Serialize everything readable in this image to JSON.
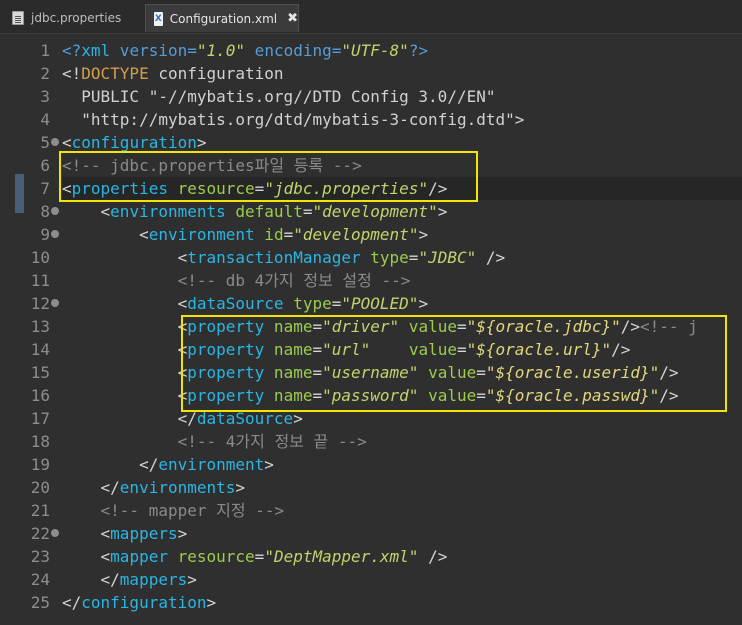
{
  "tabs": [
    {
      "label": "jdbc.properties",
      "icon": "properties-file-icon",
      "active": false
    },
    {
      "label": "Configuration.xml",
      "icon": "xml-file-icon",
      "active": true,
      "close": "✖"
    }
  ],
  "editor": {
    "lines": [
      {
        "n": "1",
        "tokens": [
          [
            "pi",
            "<?"
          ],
          [
            "tag",
            "xml"
          ],
          [
            "pi",
            " version="
          ],
          [
            "val",
            "\"1.0\""
          ],
          [
            "pi",
            " encoding="
          ],
          [
            "val",
            "\"UTF-8\""
          ],
          [
            "pi",
            "?>"
          ]
        ]
      },
      {
        "n": "2",
        "tokens": [
          [
            "pun",
            "<!"
          ],
          [
            "doctype",
            "DOCTYPE"
          ],
          [
            "doc",
            " configuration"
          ]
        ]
      },
      {
        "n": "3",
        "tokens": [
          [
            "doc",
            "  PUBLIC \"-//mybatis.org//DTD Config 3.0//EN\""
          ]
        ]
      },
      {
        "n": "4",
        "tokens": [
          [
            "doc",
            "  \"http://mybatis.org/dtd/mybatis-3-config.dtd\""
          ],
          [
            "pun",
            ">"
          ]
        ]
      },
      {
        "n": "5",
        "fold": true,
        "tokens": [
          [
            "pun",
            "<"
          ],
          [
            "tag",
            "configuration"
          ],
          [
            "pun",
            ">"
          ]
        ]
      },
      {
        "n": "6",
        "tokens": [
          [
            "com",
            "<!-- jdbc.properties파일 등록 -->"
          ]
        ]
      },
      {
        "n": "7",
        "current": true,
        "tokens": [
          [
            "pun",
            "<"
          ],
          [
            "tag",
            "properties"
          ],
          [
            "attr",
            " resource"
          ],
          [
            "pun",
            "="
          ],
          [
            "val",
            "\"jdbc.properties\""
          ],
          [
            "pun",
            "/>"
          ]
        ]
      },
      {
        "n": "8",
        "fold": true,
        "tokens": [
          [
            "pun",
            "    <"
          ],
          [
            "tag",
            "environments"
          ],
          [
            "attr",
            " default"
          ],
          [
            "pun",
            "="
          ],
          [
            "val",
            "\"development\""
          ],
          [
            "pun",
            ">"
          ]
        ]
      },
      {
        "n": "9",
        "fold": true,
        "tokens": [
          [
            "pun",
            "        <"
          ],
          [
            "tag",
            "environment"
          ],
          [
            "attr",
            " id"
          ],
          [
            "pun",
            "="
          ],
          [
            "val",
            "\"development\""
          ],
          [
            "pun",
            ">"
          ]
        ]
      },
      {
        "n": "10",
        "tokens": [
          [
            "pun",
            "            <"
          ],
          [
            "tag",
            "transactionManager"
          ],
          [
            "attr",
            " type"
          ],
          [
            "pun",
            "="
          ],
          [
            "val",
            "\"JDBC\""
          ],
          [
            "pun",
            " />"
          ]
        ]
      },
      {
        "n": "11",
        "tokens": [
          [
            "com",
            "            <!-- db 4가지 정보 설정 -->"
          ]
        ]
      },
      {
        "n": "12",
        "fold": true,
        "tokens": [
          [
            "pun",
            "            <"
          ],
          [
            "tag",
            "dataSource"
          ],
          [
            "attr",
            " type"
          ],
          [
            "pun",
            "="
          ],
          [
            "val",
            "\"POOLED\""
          ],
          [
            "pun",
            ">"
          ]
        ]
      },
      {
        "n": "13",
        "tokens": [
          [
            "pun",
            "            <"
          ],
          [
            "tag",
            "property"
          ],
          [
            "attr",
            " name"
          ],
          [
            "pun",
            "="
          ],
          [
            "val",
            "\"driver\""
          ],
          [
            "attr",
            " value"
          ],
          [
            "pun",
            "="
          ],
          [
            "val2",
            "\"${oracle.jdbc}\""
          ],
          [
            "pun",
            "/>"
          ],
          [
            "com",
            "<!-- j"
          ]
        ]
      },
      {
        "n": "14",
        "tokens": [
          [
            "pun",
            "            <"
          ],
          [
            "tag",
            "property"
          ],
          [
            "attr",
            " name"
          ],
          [
            "pun",
            "="
          ],
          [
            "val",
            "\"url\""
          ],
          [
            "attr",
            "    value"
          ],
          [
            "pun",
            "="
          ],
          [
            "val2",
            "\"${oracle.url}\""
          ],
          [
            "pun",
            "/>"
          ]
        ]
      },
      {
        "n": "15",
        "tokens": [
          [
            "pun",
            "            <"
          ],
          [
            "tag",
            "property"
          ],
          [
            "attr",
            " name"
          ],
          [
            "pun",
            "="
          ],
          [
            "val",
            "\"username\""
          ],
          [
            "attr",
            " value"
          ],
          [
            "pun",
            "="
          ],
          [
            "val2",
            "\"${oracle.userid}\""
          ],
          [
            "pun",
            "/>"
          ]
        ]
      },
      {
        "n": "16",
        "tokens": [
          [
            "pun",
            "            <"
          ],
          [
            "tag",
            "property"
          ],
          [
            "attr",
            " name"
          ],
          [
            "pun",
            "="
          ],
          [
            "val",
            "\"password\""
          ],
          [
            "attr",
            " value"
          ],
          [
            "pun",
            "="
          ],
          [
            "val2",
            "\"${oracle.passwd}\""
          ],
          [
            "pun",
            "/>"
          ]
        ]
      },
      {
        "n": "17",
        "tokens": [
          [
            "pun",
            "            </"
          ],
          [
            "tag",
            "dataSource"
          ],
          [
            "pun",
            ">"
          ]
        ]
      },
      {
        "n": "18",
        "tokens": [
          [
            "com",
            "            <!-- 4가지 정보 끝 -->"
          ]
        ]
      },
      {
        "n": "19",
        "tokens": [
          [
            "pun",
            "        </"
          ],
          [
            "tag",
            "environment"
          ],
          [
            "pun",
            ">"
          ]
        ]
      },
      {
        "n": "20",
        "tokens": [
          [
            "pun",
            "    </"
          ],
          [
            "tag",
            "environments"
          ],
          [
            "pun",
            ">"
          ]
        ]
      },
      {
        "n": "21",
        "tokens": [
          [
            "com",
            "    <!-- mapper 지정 -->"
          ]
        ]
      },
      {
        "n": "22",
        "fold": true,
        "tokens": [
          [
            "pun",
            "    <"
          ],
          [
            "tag",
            "mappers"
          ],
          [
            "pun",
            ">"
          ]
        ]
      },
      {
        "n": "23",
        "tokens": [
          [
            "pun",
            "    <"
          ],
          [
            "tag",
            "mapper"
          ],
          [
            "attr",
            " resource"
          ],
          [
            "pun",
            "="
          ],
          [
            "val",
            "\"DeptMapper.xml\""
          ],
          [
            "pun",
            " />"
          ]
        ]
      },
      {
        "n": "24",
        "tokens": [
          [
            "pun",
            "    </"
          ],
          [
            "tag",
            "mappers"
          ],
          [
            "pun",
            ">"
          ]
        ]
      },
      {
        "n": "25",
        "tokens": [
          [
            "pun",
            "</"
          ],
          [
            "tag",
            "configuration"
          ],
          [
            "pun",
            ">"
          ]
        ]
      }
    ],
    "highlight_color": "#f2e600",
    "colors": {
      "tag": "#29b6e4",
      "attribute": "#9ccc4e",
      "value": "#c0d56c",
      "comment": "#8a8a8a",
      "background": "#2f2f2f"
    }
  }
}
